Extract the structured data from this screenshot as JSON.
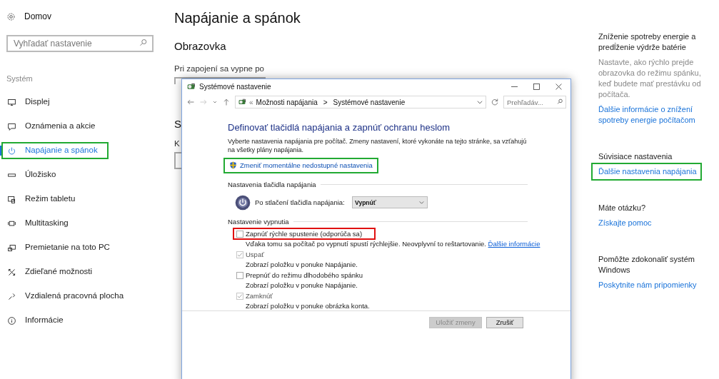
{
  "sidebar": {
    "home": "Domov",
    "search": {
      "placeholder": "Vyhľadať nastavenie"
    },
    "section": "Systém",
    "items": [
      {
        "label": "Displej",
        "selected": false
      },
      {
        "label": "Oznámenia a akcie",
        "selected": false
      },
      {
        "label": "Napájanie a spánok",
        "selected": true,
        "color": "#22aa33"
      },
      {
        "label": "Úložisko",
        "selected": false
      },
      {
        "label": "Režim tabletu",
        "selected": false
      },
      {
        "label": "Multitasking",
        "selected": false
      },
      {
        "label": "Premietanie na toto PC",
        "selected": false
      },
      {
        "label": "Zdieľané možnosti",
        "selected": false
      },
      {
        "label": "Vzdialená pracovná plocha",
        "selected": false
      },
      {
        "label": "Informácie",
        "selected": false
      }
    ]
  },
  "main": {
    "title": "Napájanie a spánok",
    "section_1": "Obrazovka",
    "label_1": "Pri zapojení sa vypne po",
    "section_2": "S",
    "label_2": "K"
  },
  "aside": {
    "groups": [
      {
        "heading": "Zníženie spotreby energie a predĺženie výdrže batérie",
        "text": "Nastavte, ako rýchlo prejde obrazovka do režimu spánku, keď budete mať prestávku od počítača.",
        "link": "Ďalšie informácie o znížení spotreby energie počítačom"
      },
      {
        "heading": "Súvisiace nastavenia",
        "link": "Ďalšie nastavenia napájania",
        "color": "#22aa33"
      },
      {
        "heading": "Máte otázku?",
        "link": "Získajte pomoc"
      },
      {
        "heading": "Pomôžte zdokonaliť systém Windows",
        "link": "Poskytnite nám pripomienky"
      }
    ]
  },
  "dialog": {
    "title": "Systémové nastavenie",
    "breadcrumb": [
      "Možnosti napájania",
      "Systémové nastavenie"
    ],
    "overflow": "«",
    "separator": ">",
    "search": {
      "placeholder": "Prehľadáv..."
    },
    "heading": "Definovať tlačidlá napájania a zapnúť ochranu heslom",
    "intro": "Vyberte nastavenia napájania pre počítač. Zmeny nastavení, ktoré vykonáte na tejto stránke, sa vzťahujú na všetky plány napájania.",
    "admin_link": {
      "label": "Zmeniť momentálne nedostupné nastavenia",
      "color": "#22aa33"
    },
    "button_section": "Nastavenia tlačidla napájania",
    "power_label": "Po stlačení tlačidla napájania:",
    "power_value": "Vypnúť",
    "shutdown_section": "Nastavenie vypnutia",
    "options": [
      {
        "label": "Zapnúť rýchle spustenie (odporúča sa)",
        "checked": false,
        "disabled": false,
        "description": "Vďaka tomu sa počítač po vypnutí spustí rýchlejšie. Neovplyvní to reštartovanie.",
        "link": "Ďalšie informácie",
        "color": "#e01010"
      },
      {
        "label": "Uspať",
        "checked": true,
        "disabled": true,
        "description": "Zobrazí položku v ponuke Napájanie."
      },
      {
        "label": "Prepnúť do režimu dlhodobého spánku",
        "checked": false,
        "disabled": false,
        "description": "Zobrazí položku v ponuke Napájanie."
      },
      {
        "label": "Zamknúť",
        "checked": true,
        "disabled": true,
        "description": "Zobrazí položku v ponuke obrázka konta."
      }
    ],
    "buttons": [
      {
        "label": "Uložiť zmeny",
        "disabled": true
      },
      {
        "label": "Zrušiť",
        "disabled": false
      }
    ]
  }
}
